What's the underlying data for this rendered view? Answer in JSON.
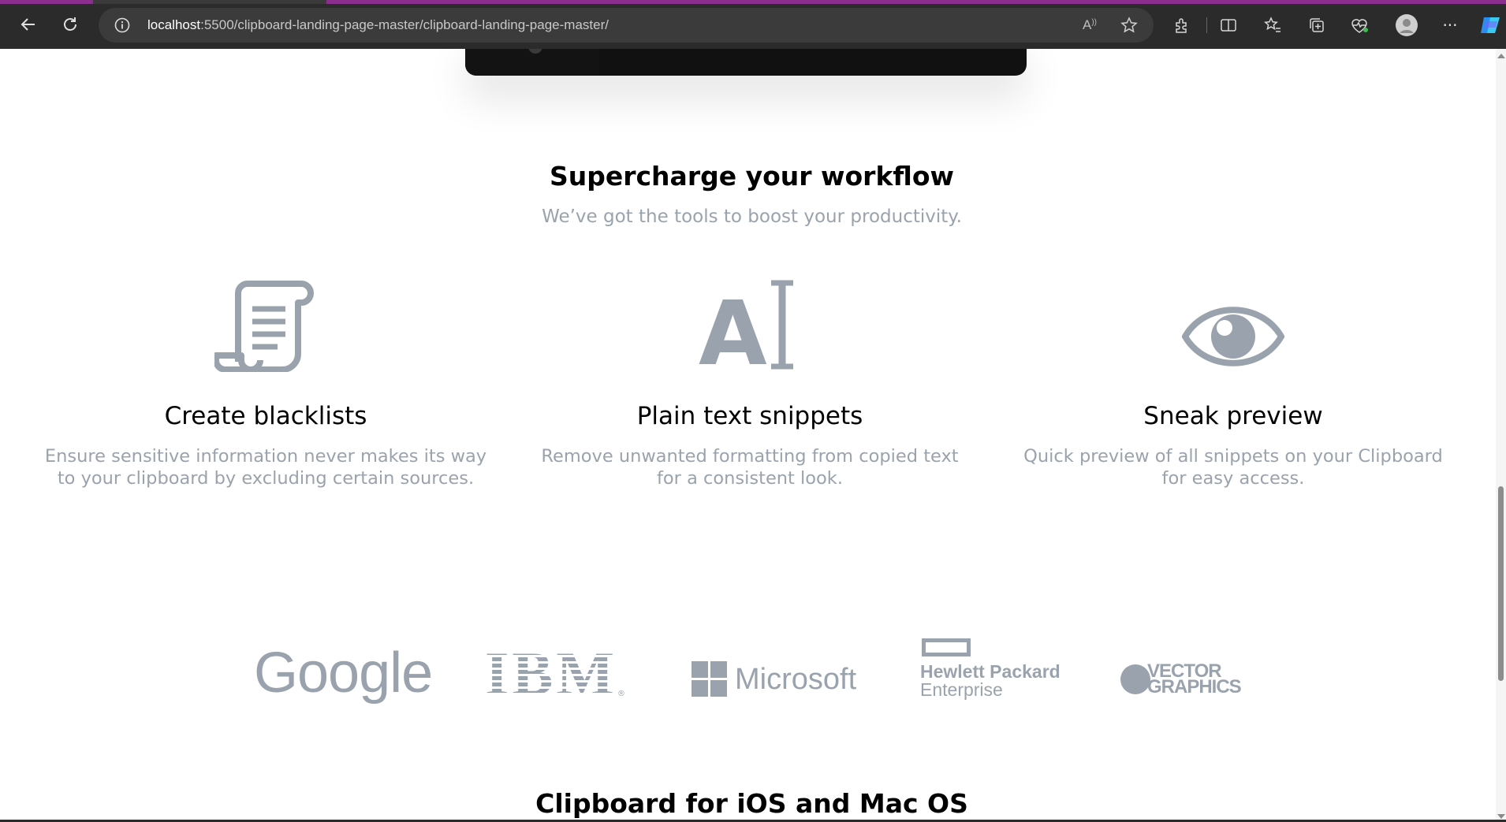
{
  "browser": {
    "url_host": "localhost",
    "url_path": ":5500/clipboard-landing-page-master/clipboard-landing-page-master/",
    "read_aloud_label": "A",
    "more_label": "···"
  },
  "workflow": {
    "title": "Supercharge your workflow",
    "subtitle": "We’ve got the tools to boost your productivity.",
    "features": [
      {
        "icon": "blacklist-scroll-icon",
        "title": "Create blacklists",
        "desc_line1": "Ensure sensitive information never makes its way",
        "desc_line2": "to your clipboard by excluding certain sources."
      },
      {
        "icon": "text-cursor-icon",
        "title": "Plain text snippets",
        "desc_line1": "Remove unwanted formatting from copied text",
        "desc_line2": "for a consistent look."
      },
      {
        "icon": "eye-icon",
        "title": "Sneak preview",
        "desc_line1": "Quick preview of all snippets on your Clipboard",
        "desc_line2": "for easy access."
      }
    ]
  },
  "partners": {
    "google": "Google",
    "ibm": "IBM",
    "microsoft": "Microsoft",
    "hp_line1": "Hewlett Packard",
    "hp_line2": "Enterprise",
    "vector_line1": "VECTOR",
    "vector_line2": "GRAPHICS"
  },
  "next_section": {
    "title": "Clipboard for iOS and Mac OS"
  },
  "colors": {
    "heading": "#000000",
    "muted": "#9aa3ad",
    "icon_gray": "#9aa3ad",
    "chrome": "#2b2b2b",
    "accent_tab": "#8a2f8e"
  }
}
